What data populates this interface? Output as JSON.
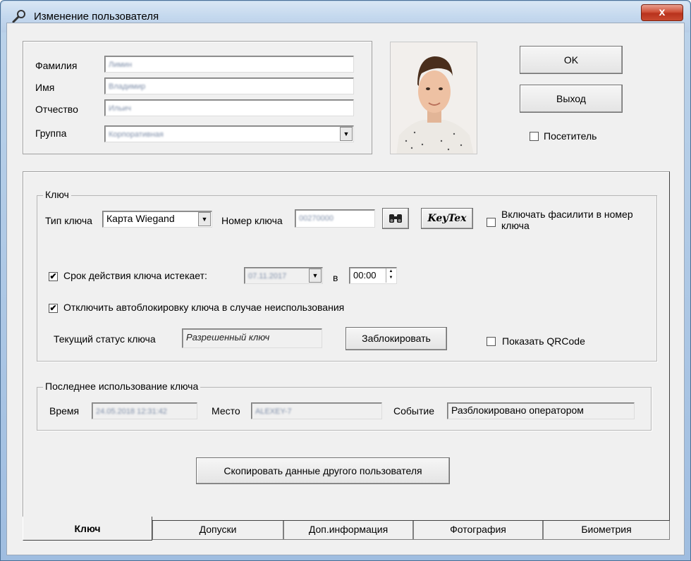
{
  "window": {
    "title": "Изменение пользователя",
    "close_label": "x"
  },
  "person": {
    "surname_label": "Фамилия",
    "surname_value": "Лимин",
    "name_label": "Имя",
    "name_value": "Владимир",
    "patronymic_label": "Отчество",
    "patronymic_value": "Ильич",
    "group_label": "Группа",
    "group_value": "Корпоративная"
  },
  "actions": {
    "ok_label": "OK",
    "exit_label": "Выход",
    "visitor_label": "Посетитель",
    "visitor_checked": false
  },
  "key_group": {
    "title": "Ключ",
    "type_label": "Тип ключа",
    "type_value": "Карта Wiegand",
    "number_label": "Номер ключа",
    "number_value": "00270000",
    "keytex_label": "KeyTex",
    "facility_label": "Включать фасилити в номер ключа",
    "facility_checked": false,
    "expire_label": "Срок действия ключа истекает:",
    "expire_checked": true,
    "expire_date": "07.11.2017",
    "in_label": "в",
    "expire_time": "00:00",
    "autoblock_label": "Отключить автоблокировку ключа в случае неиспользования",
    "autoblock_checked": true,
    "status_label": "Текущий статус ключа",
    "status_value": "Разрешенный ключ",
    "block_label": "Заблокировать",
    "qr_label": "Показать QRCode",
    "qr_checked": false
  },
  "last_use": {
    "title": "Последнее использование ключа",
    "time_label": "Время",
    "time_value": "24.05.2018 12:31:42",
    "place_label": "Место",
    "place_value": "ALEXEY-7",
    "event_label": "Событие",
    "event_value": "Разблокировано оператором"
  },
  "copy_label": "Скопировать данные другого пользователя",
  "tabs": [
    {
      "label": "Ключ",
      "active": true
    },
    {
      "label": "Допуски",
      "active": false
    },
    {
      "label": "Доп.информация",
      "active": false
    },
    {
      "label": "Фотография",
      "active": false
    },
    {
      "label": "Биометрия",
      "active": false
    }
  ],
  "check_glyph": "✔",
  "dropdown_glyph": "▼"
}
